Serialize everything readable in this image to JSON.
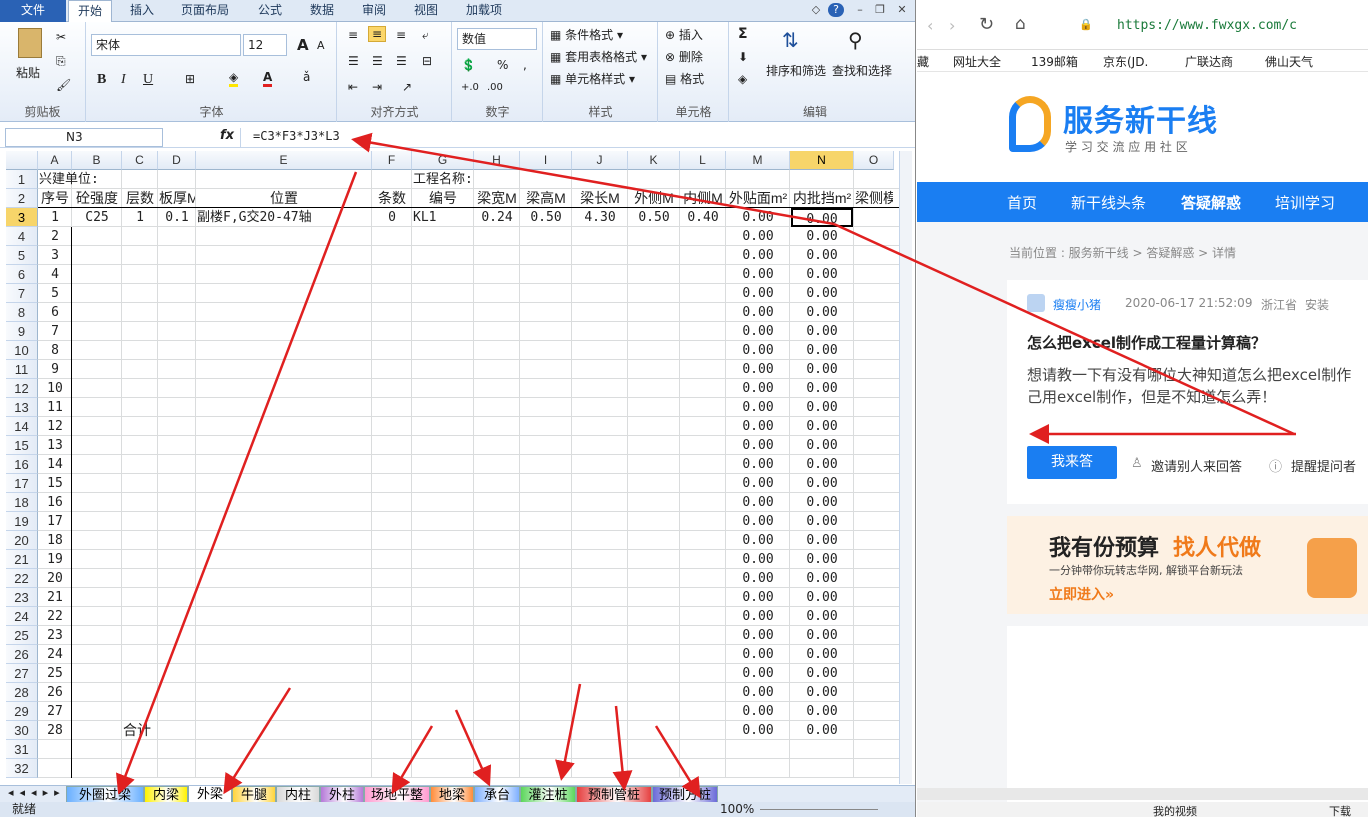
{
  "excel": {
    "tabs": [
      "文件",
      "开始",
      "插入",
      "页面布局",
      "公式",
      "数据",
      "审阅",
      "视图",
      "加载项"
    ],
    "clipboard": {
      "paste": "粘贴",
      "label": "剪贴板"
    },
    "font": {
      "name": "宋体",
      "size": "12",
      "label": "字体",
      "bold": "B",
      "italic": "I",
      "underline": "U",
      "grow": "A",
      "shrink": "A"
    },
    "align": {
      "label": "对齐方式"
    },
    "number": {
      "format": "数值",
      "label": "数字",
      "percent": "%",
      "comma": ","
    },
    "styles": {
      "cond": "条件格式",
      "table": "套用表格格式",
      "cell": "单元格样式",
      "label": "样式"
    },
    "cells": {
      "insert": "插入",
      "delete": "删除",
      "format": "格式",
      "label": "单元格"
    },
    "editing": {
      "sum": "Σ",
      "sort": "排序和筛选",
      "find": "查找和选择",
      "label": "编辑"
    },
    "namebox": "N3",
    "fx": "fx",
    "formula": "=C3*F3*J3*L3",
    "columns": [
      "A",
      "B",
      "C",
      "D",
      "E",
      "F",
      "G",
      "H",
      "I",
      "J",
      "K",
      "L",
      "M",
      "N",
      "O"
    ],
    "row1": {
      "a": "兴建单位:",
      "g": "工程名称:"
    },
    "headers": [
      "序号",
      "砼强度",
      "层数",
      "板厚M",
      "位置",
      "条数",
      "编号",
      "梁宽M",
      "梁高M",
      "梁长M",
      "外侧M",
      "内侧M",
      "外贴面m²",
      "内批挡m²",
      "梁侧模"
    ],
    "row3": [
      "1",
      "C25",
      "1",
      "0.1",
      "副楼F,G交20-47轴",
      "0",
      "KL1",
      "0.24",
      "0.50",
      "4.30",
      "0.50",
      "0.40",
      "0.00",
      "0.00"
    ],
    "zero": "0.00",
    "total_label": "合计",
    "sheets": [
      "外圈过梁",
      "内梁",
      "外梁",
      "牛腿",
      "内柱",
      "外柱",
      "场地平整",
      "地梁",
      "承台",
      "灌注桩",
      "预制管桩",
      "预制方桩"
    ],
    "status": {
      "ready": "就绪",
      "zoom": "100%"
    }
  },
  "browser": {
    "url": "https://www.fwxgx.com/c",
    "bookmarks": [
      "藏",
      "网址大全",
      "139邮箱",
      "京东(JD.",
      "广联达商",
      "佛山天气"
    ],
    "site_name": "服务新干线",
    "site_slogan": "学 习 交 流 应 用 社 区",
    "nav": [
      "首页",
      "新干线头条",
      "答疑解惑",
      "培训学习"
    ],
    "breadcrumb": "当前位置 : 服务新干线 > 答疑解惑 > 详情",
    "question": {
      "user": "瘦瘦小猪",
      "time": "2020-06-17 21:52:09",
      "location": "浙江省",
      "tag": "安装",
      "title": "怎么把excel制作成工程量计算稿？",
      "body1": "想请教一下有没有哪位大神知道怎么把excel制作",
      "body2": "己用excel制作，但是不知道怎么弄！",
      "answer_btn": "我来答",
      "invite": "邀请别人来回答",
      "remind": "提醒提问者"
    },
    "ad": {
      "title1": "我有份预算",
      "title2": "找人代做",
      "sub": "一分钟带你玩转志华网, 解锁平台新玩法",
      "cta": "立即进入»"
    },
    "footer": [
      "我的视频",
      "下载"
    ]
  },
  "colors": {
    "file_tab": "#2a62b5",
    "nav": "#1a7ef2",
    "arrow": "#e02020",
    "brand": "#1a7ef2",
    "ad_accent": "#f07a1a"
  }
}
